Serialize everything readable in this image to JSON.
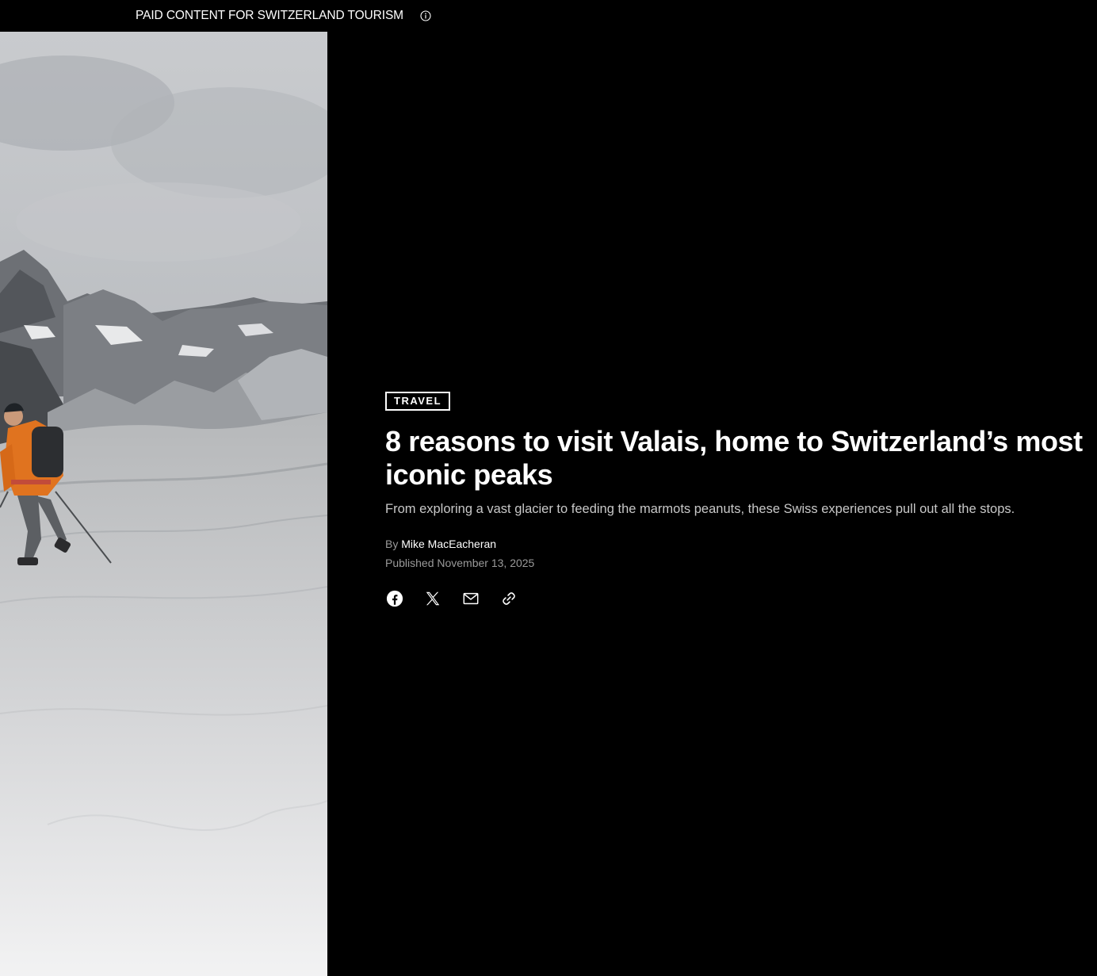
{
  "topbar": {
    "label": "PAID CONTENT FOR SWITZERLAND TOURISM",
    "info_icon": "info-icon"
  },
  "hero_image": {
    "description_icon": "glacier-hiker-photo"
  },
  "article": {
    "category": "TRAVEL",
    "headline": "8 reasons to visit Valais, home to Switzerland’s most iconic peaks",
    "dek": "From exploring a vast glacier to feeding the marmots peanuts, these Swiss experiences pull out all the stops.",
    "by_prefix": "By",
    "author": "Mike MacEacheran",
    "published": "Published November 13, 2025"
  },
  "share": {
    "icons": [
      "facebook-icon",
      "x-icon",
      "email-icon",
      "link-icon"
    ]
  },
  "colors": {
    "background": "#000000",
    "text": "#ffffff",
    "muted": "#9a9a9a"
  }
}
